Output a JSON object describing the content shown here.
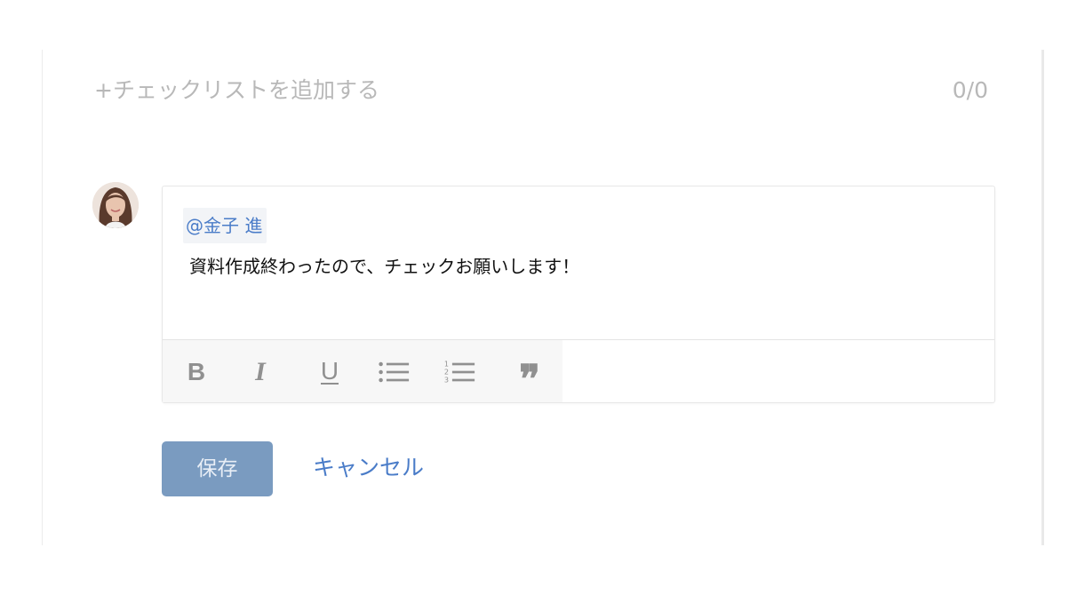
{
  "checklist": {
    "add_label": "+チェックリストを追加する",
    "count": "0/0"
  },
  "comment": {
    "avatar_icon": "user-avatar-photo",
    "mention": "@金子 進",
    "text": "資料作成終わったので、チェックお願いします！"
  },
  "toolbar": {
    "bold_label": "B",
    "italic_label": "I",
    "underline_label": "U",
    "bullet_icon": "bulleted-list-icon",
    "ordered_icon": "numbered-list-icon",
    "quote_label": "❞"
  },
  "actions": {
    "save_label": "保存",
    "cancel_label": "キャンセル"
  },
  "colors": {
    "accent": "#4a7cc8",
    "save_bg": "#7a9bc0",
    "muted_text": "#b8b8b8"
  }
}
